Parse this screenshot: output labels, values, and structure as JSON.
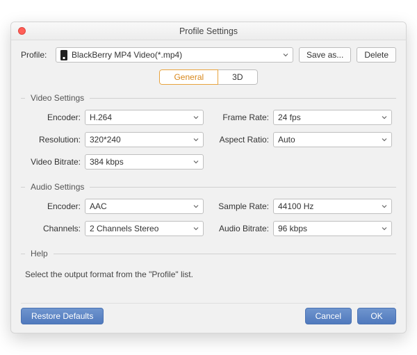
{
  "window": {
    "title": "Profile Settings"
  },
  "profile": {
    "label": "Profile:",
    "value": "BlackBerry MP4 Video(*.mp4)",
    "save_as": "Save as...",
    "delete": "Delete"
  },
  "tabs": {
    "general": "General",
    "three_d": "3D"
  },
  "video": {
    "section": "Video Settings",
    "encoder_label": "Encoder:",
    "encoder_value": "H.264",
    "resolution_label": "Resolution:",
    "resolution_value": "320*240",
    "bitrate_label": "Video Bitrate:",
    "bitrate_value": "384 kbps",
    "frame_rate_label": "Frame Rate:",
    "frame_rate_value": "24 fps",
    "aspect_label": "Aspect Ratio:",
    "aspect_value": "Auto"
  },
  "audio": {
    "section": "Audio Settings",
    "encoder_label": "Encoder:",
    "encoder_value": "AAC",
    "channels_label": "Channels:",
    "channels_value": "2 Channels Stereo",
    "sample_rate_label": "Sample Rate:",
    "sample_rate_value": "44100 Hz",
    "bitrate_label": "Audio Bitrate:",
    "bitrate_value": "96 kbps"
  },
  "help": {
    "section": "Help",
    "text": "Select the output format from the \"Profile\" list."
  },
  "footer": {
    "restore": "Restore Defaults",
    "cancel": "Cancel",
    "ok": "OK"
  }
}
